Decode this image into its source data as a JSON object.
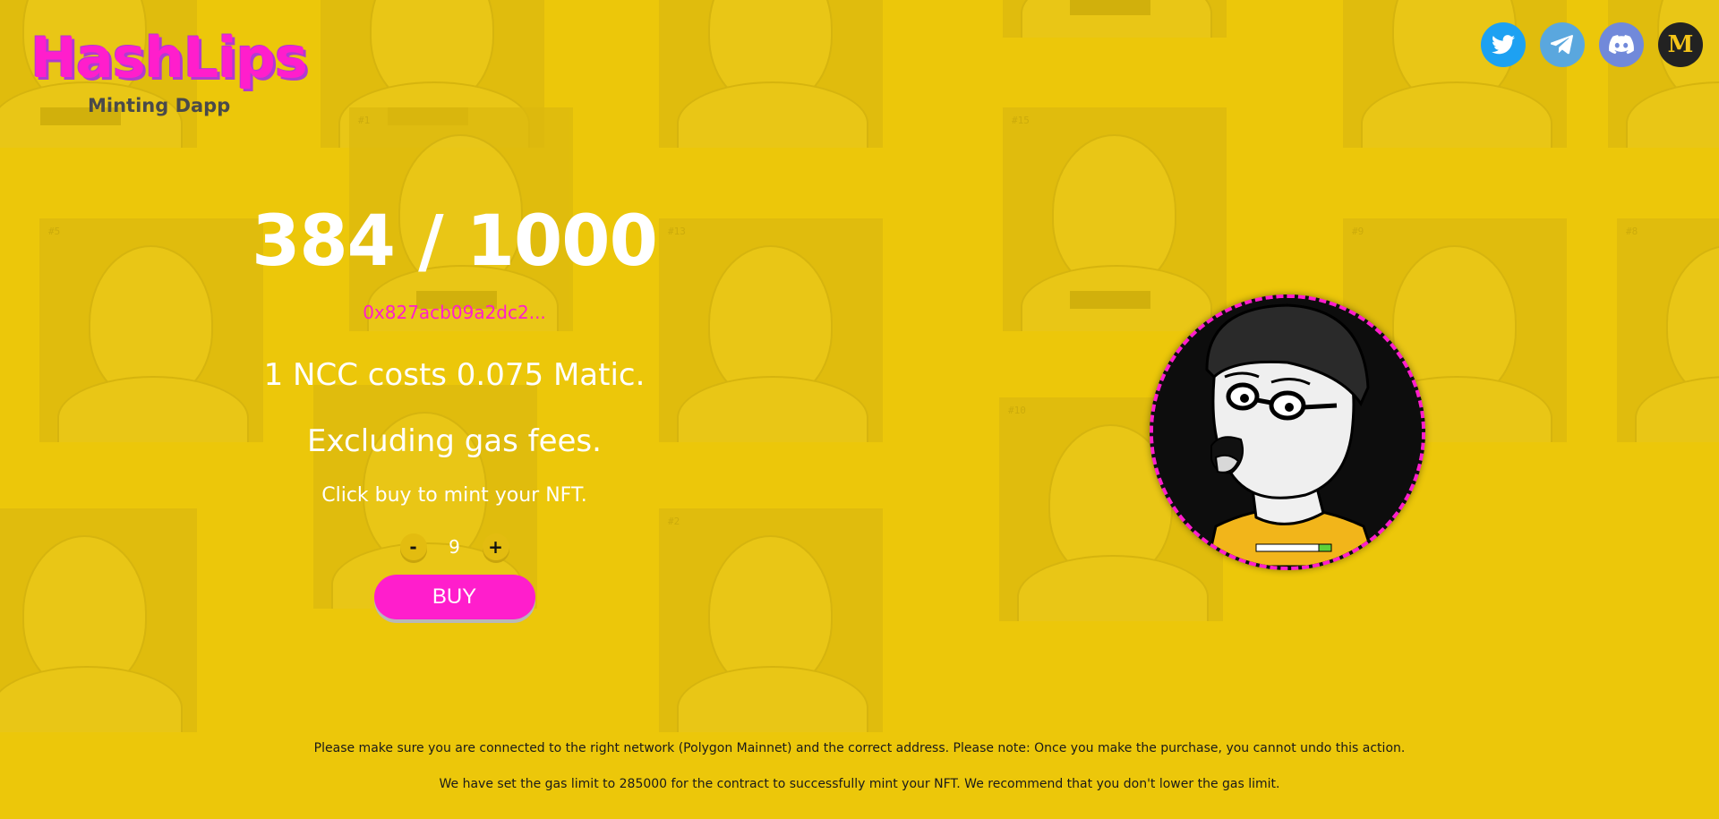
{
  "header": {
    "logo_title": "HashLips",
    "logo_subtitle": "Minting Dapp"
  },
  "socials": [
    {
      "name": "twitter",
      "icon": "twitter-icon"
    },
    {
      "name": "telegram",
      "icon": "telegram-icon"
    },
    {
      "name": "discord",
      "icon": "discord-icon"
    },
    {
      "name": "medium",
      "icon": "medium-icon",
      "label": "M"
    }
  ],
  "mint": {
    "supply": "384 / 1000",
    "contract_address": "0x827acb09a2dc2...",
    "cost_text": "1 NCC costs 0.075 Matic.",
    "gas_text": "Excluding gas fees.",
    "cta_text": "Click buy to mint your NFT.",
    "decrement_label": "-",
    "increment_label": "+",
    "quantity": "9",
    "buy_label": "BUY"
  },
  "background_tiles": [
    {
      "number": "#1"
    },
    {
      "number": "#5"
    },
    {
      "number": "#13"
    },
    {
      "number": "#15"
    },
    {
      "number": "#9"
    },
    {
      "number": "#8"
    },
    {
      "number": "#10"
    },
    {
      "number": "#2"
    }
  ],
  "footer": {
    "network_notice": "Please make sure you are connected to the right network (Polygon Mainnet) and the correct address. Please note: Once you make the purchase, you cannot undo this action.",
    "gas_notice": "We have set the gas limit to 285000 for the contract to successfully mint your NFT. We recommend that you don't lower the gas limit."
  },
  "colors": {
    "background": "#ecc70a",
    "accent": "#ff1ecc",
    "text": "#ffffff"
  }
}
